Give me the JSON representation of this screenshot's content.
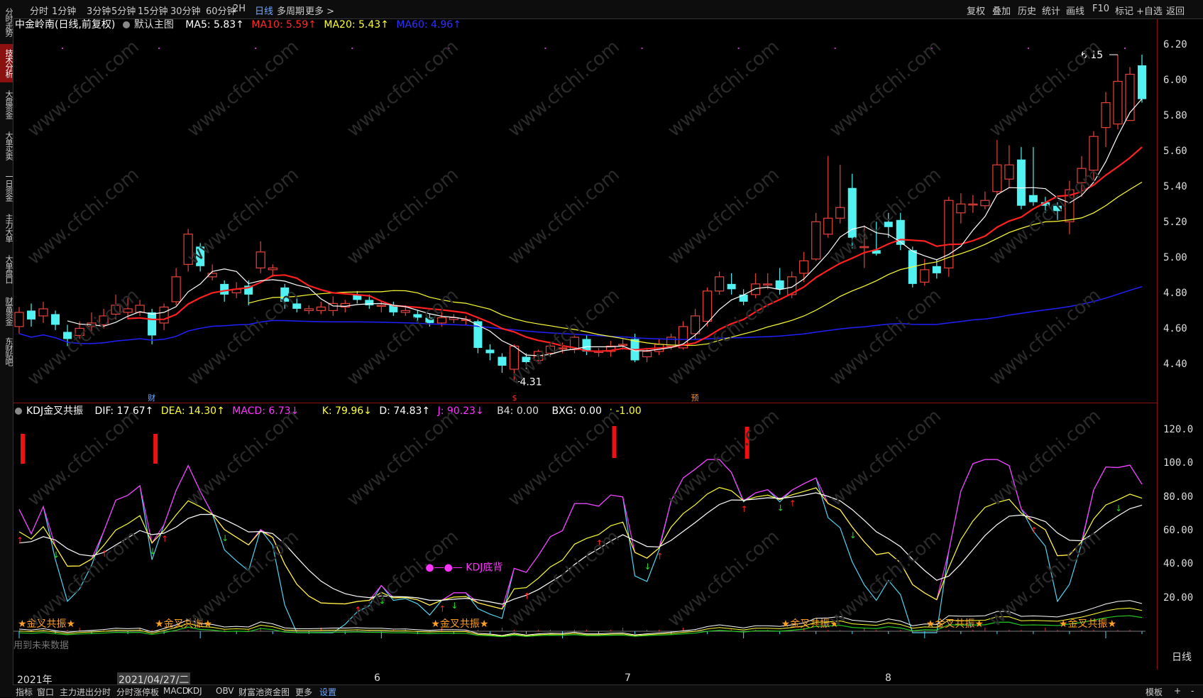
{
  "left_sidebar": [
    {
      "label": "分时走势",
      "active": false
    },
    {
      "label": "技术分析",
      "active": true
    },
    {
      "label": "大盘资金",
      "active": false
    },
    {
      "label": "大单买卖",
      "active": false
    },
    {
      "label": "一日资金",
      "active": false
    },
    {
      "label": "主力大单",
      "active": false
    },
    {
      "label": "大单盘口",
      "active": false
    },
    {
      "label": "财富资金",
      "active": false
    },
    {
      "label": "东财贴吧",
      "active": false
    }
  ],
  "top_periods": [
    "分时",
    "1分钟",
    "3分钟",
    "5分钟",
    "15分钟",
    "30分钟",
    "60分钟",
    "2H",
    "日线",
    "多周期",
    "更多 >"
  ],
  "top_active_period": "日线",
  "top_tools": [
    "复权",
    "叠加",
    "历史",
    "统计",
    "画线",
    "F10",
    "标记",
    "+自选",
    "返回"
  ],
  "main_legend": {
    "title": "中金岭南(日线,前复权)",
    "main_chart_label": "默认主图",
    "ma5": "MA5: 5.83↑",
    "ma10": "MA10: 5.59↑",
    "ma20": "MA20: 5.43↑",
    "ma60": "MA60: 4.96↑"
  },
  "sub_legend": {
    "name": "KDJ金叉共振",
    "dif": "DIF: 17.67↑",
    "dea": "DEA: 14.30↑",
    "macd": "MACD: 6.73↓",
    "k": "K: 79.96↓",
    "d": "D: 74.83↑",
    "j": "J: 90.23↓",
    "b4": "B4: 0.00",
    "bxg": "BXG: 0.00",
    ":": ": -1.00"
  },
  "annotations": {
    "high_label": "6.15",
    "low_label": "4.31",
    "kdj_divergence": "KDJ底背",
    "golden_cross": "★金叉共振★",
    "future_data": "用到未来数据",
    "marker_cai": "财",
    "marker_s": "$",
    "marker_yu": "预"
  },
  "main_y_labels": [
    "6.20",
    "6.00",
    "5.80",
    "5.60",
    "5.40",
    "5.20",
    "5.00",
    "4.80",
    "4.60",
    "4.40"
  ],
  "sub_y_labels": [
    "120.0",
    "100.0",
    "80.00",
    "60.00",
    "40.00",
    "20.00"
  ],
  "date_labels": [
    "2021年",
    "2021/04/27/二",
    "6",
    "7",
    "8"
  ],
  "right_bottom_label": "日线",
  "bottom_tabs": [
    "指标",
    "窗口",
    "主力进出分时",
    "分时涨停板",
    "MACD",
    "KDJ",
    "OBV",
    "财富池资金图",
    "更多",
    "设置"
  ],
  "bottom_active": "设置",
  "bottom_right": [
    "模板",
    "+",
    "-"
  ],
  "watermark": "www.cfchi.com",
  "colors": {
    "up": "#e8423a",
    "down": "#53f2f2",
    "ma5": "#ffffff",
    "ma10": "#ff2020",
    "ma20": "#ffff33",
    "ma60": "#2020ff",
    "k": "#ffffff",
    "d": "#ffff33",
    "j": "#ff33ff",
    "frame": "#8b1010"
  },
  "chart_data": {
    "type": "candlestick",
    "ylim": [
      4.3,
      6.25
    ],
    "candles": [
      [
        4.62,
        4.7,
        4.73,
        4.58
      ],
      [
        4.71,
        4.66,
        4.75,
        4.62
      ],
      [
        4.68,
        4.72,
        4.76,
        4.64
      ],
      [
        4.69,
        4.63,
        4.71,
        4.6
      ],
      [
        4.59,
        4.55,
        4.63,
        4.51
      ],
      [
        4.57,
        4.61,
        4.65,
        4.55
      ],
      [
        4.62,
        4.64,
        4.7,
        4.58
      ],
      [
        4.63,
        4.68,
        4.72,
        4.61
      ],
      [
        4.69,
        4.74,
        4.8,
        4.66
      ],
      [
        4.7,
        4.72,
        4.78,
        4.66
      ],
      [
        4.7,
        4.74,
        4.77,
        4.68
      ],
      [
        4.7,
        4.57,
        4.72,
        4.52
      ],
      [
        4.64,
        4.73,
        4.75,
        4.6
      ],
      [
        4.76,
        4.9,
        4.95,
        4.74
      ],
      [
        4.97,
        5.14,
        5.17,
        4.93
      ],
      [
        5.07,
        4.96,
        5.09,
        4.93
      ],
      [
        4.9,
        4.92,
        4.97,
        4.88
      ],
      [
        4.86,
        4.8,
        4.88,
        4.76
      ],
      [
        4.81,
        4.83,
        4.87,
        4.78
      ],
      [
        4.85,
        4.8,
        4.88,
        4.74
      ],
      [
        4.95,
        5.04,
        5.1,
        4.92
      ],
      [
        4.94,
        4.95,
        4.97,
        4.9
      ],
      [
        4.84,
        4.76,
        4.86,
        4.72
      ],
      [
        4.75,
        4.72,
        4.78,
        4.7
      ],
      [
        4.71,
        4.72,
        4.74,
        4.69
      ],
      [
        4.71,
        4.73,
        4.76,
        4.69
      ],
      [
        4.71,
        4.75,
        4.79,
        4.68
      ],
      [
        4.73,
        4.75,
        4.77,
        4.7
      ],
      [
        4.8,
        4.77,
        4.82,
        4.75
      ],
      [
        4.77,
        4.74,
        4.8,
        4.72
      ],
      [
        4.74,
        4.74,
        4.76,
        4.7
      ],
      [
        4.74,
        4.7,
        4.76,
        4.68
      ],
      [
        4.7,
        4.71,
        4.74,
        4.68
      ],
      [
        4.69,
        4.67,
        4.71,
        4.64
      ],
      [
        4.67,
        4.64,
        4.69,
        4.62
      ],
      [
        4.64,
        4.67,
        4.7,
        4.62
      ],
      [
        4.66,
        4.67,
        4.69,
        4.64
      ],
      [
        4.66,
        4.66,
        4.68,
        4.63
      ],
      [
        4.65,
        4.5,
        4.66,
        4.47
      ],
      [
        4.49,
        4.47,
        4.52,
        4.43
      ],
      [
        4.45,
        4.4,
        4.47,
        4.36
      ],
      [
        4.38,
        4.51,
        4.52,
        4.31
      ],
      [
        4.45,
        4.42,
        4.47,
        4.38
      ],
      [
        4.43,
        4.48,
        4.49,
        4.41
      ],
      [
        4.47,
        4.51,
        4.53,
        4.45
      ],
      [
        4.5,
        4.5,
        4.53,
        4.47
      ],
      [
        4.49,
        4.56,
        4.58,
        4.47
      ],
      [
        4.55,
        4.48,
        4.57,
        4.46
      ],
      [
        4.48,
        4.48,
        4.5,
        4.45
      ],
      [
        4.48,
        4.51,
        4.54,
        4.45
      ],
      [
        4.52,
        4.52,
        4.55,
        4.49
      ],
      [
        4.55,
        4.43,
        4.58,
        4.42
      ],
      [
        4.45,
        4.48,
        4.5,
        4.42
      ],
      [
        4.48,
        4.52,
        4.55,
        4.46
      ],
      [
        4.51,
        4.56,
        4.58,
        4.49
      ],
      [
        4.5,
        4.62,
        4.65,
        4.49
      ],
      [
        4.58,
        4.68,
        4.72,
        4.55
      ],
      [
        4.65,
        4.82,
        4.84,
        4.62
      ],
      [
        4.82,
        4.9,
        4.93,
        4.8
      ],
      [
        4.86,
        4.83,
        4.92,
        4.8
      ],
      [
        4.8,
        4.76,
        4.83,
        4.74
      ],
      [
        4.8,
        4.86,
        4.92,
        4.78
      ],
      [
        4.86,
        4.86,
        4.92,
        4.83
      ],
      [
        4.88,
        4.83,
        4.95,
        4.8
      ],
      [
        4.8,
        4.9,
        4.93,
        4.78
      ],
      [
        4.92,
        4.99,
        5.04,
        4.87
      ],
      [
        5.0,
        5.21,
        5.26,
        4.99
      ],
      [
        5.14,
        5.23,
        5.58,
        5.12
      ],
      [
        5.23,
        5.29,
        5.53,
        5.2
      ],
      [
        5.4,
        5.12,
        5.48,
        5.06
      ],
      [
        5.07,
        5.07,
        5.19,
        4.95
      ],
      [
        5.05,
        5.03,
        5.21,
        5.02
      ],
      [
        5.21,
        5.18,
        5.26,
        5.12
      ],
      [
        5.22,
        5.08,
        5.26,
        5.05
      ],
      [
        5.05,
        4.86,
        5.07,
        4.84
      ],
      [
        4.87,
        4.94,
        5.0,
        4.85
      ],
      [
        4.96,
        4.92,
        5.0,
        4.89
      ],
      [
        4.95,
        5.33,
        5.35,
        4.9
      ],
      [
        5.26,
        5.31,
        5.37,
        5.2
      ],
      [
        5.31,
        5.31,
        5.36,
        5.26
      ],
      [
        5.3,
        5.33,
        5.38,
        5.28
      ],
      [
        5.38,
        5.53,
        5.67,
        5.36
      ],
      [
        5.45,
        5.53,
        5.64,
        5.4
      ],
      [
        5.56,
        5.3,
        5.63,
        5.28
      ],
      [
        5.36,
        5.32,
        5.63,
        5.3
      ],
      [
        5.32,
        5.3,
        5.35,
        5.26
      ],
      [
        5.3,
        5.27,
        5.32,
        5.22
      ],
      [
        5.21,
        5.39,
        5.44,
        5.14
      ],
      [
        5.43,
        5.51,
        5.58,
        5.35
      ],
      [
        5.5,
        5.69,
        5.72,
        5.43
      ],
      [
        5.74,
        5.88,
        5.94,
        5.63
      ],
      [
        5.76,
        6.0,
        6.15,
        5.73
      ],
      [
        5.78,
        6.04,
        6.08,
        5.78
      ],
      [
        6.09,
        5.9,
        6.15,
        5.88
      ]
    ],
    "kdj": {
      "k": [],
      "d": [],
      "j": []
    }
  }
}
